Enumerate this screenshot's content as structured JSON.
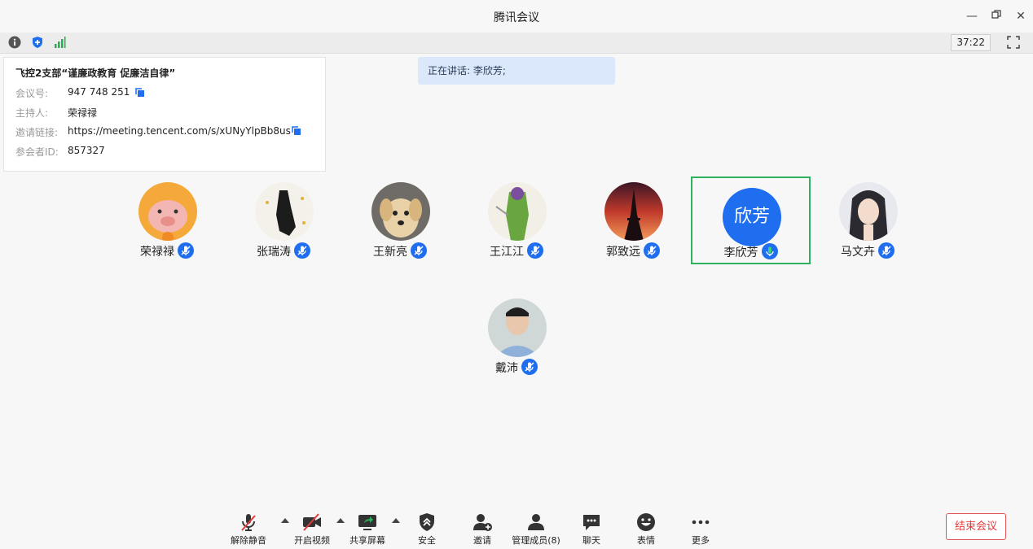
{
  "window": {
    "title": "腾讯会议"
  },
  "topbar": {
    "timer": "37:22"
  },
  "meeting": {
    "title": "飞控2支部“谨廉政教育 促廉洁自律”",
    "id_label": "会议号:",
    "id": "947 748 251",
    "host_label": "主持人:",
    "host": "荣禄禄",
    "link_label": "邀请链接:",
    "link": "https://meeting.tencent.com/s/xUNyYlpBb8us",
    "pid_label": "参会者ID:",
    "pid": "857327"
  },
  "speaking": {
    "text": "正在讲话: 李欣芳;"
  },
  "participants": [
    {
      "name": "荣禄禄",
      "avatar": "pig-cartoon"
    },
    {
      "name": "张瑞涛",
      "avatar": "ink-silhouette"
    },
    {
      "name": "王新亮",
      "avatar": "puppy-photo"
    },
    {
      "name": "王江江",
      "avatar": "anime-character"
    },
    {
      "name": "郭致远",
      "avatar": "eiffel-sunset"
    },
    {
      "name": "李欣芳",
      "avatar_text": "欣芳",
      "speaking": true
    },
    {
      "name": "马文卉",
      "avatar": "girl-portrait"
    },
    {
      "name": "戴沛",
      "avatar": "man-portrait"
    }
  ],
  "toolbar": {
    "unmute": "解除静音",
    "video": "开启视频",
    "share": "共享屏幕",
    "security": "安全",
    "invite": "邀请",
    "members": "管理成员(8)",
    "chat": "聊天",
    "emoji": "表情",
    "more": "更多",
    "end": "结束会议"
  },
  "colors": {
    "accent": "#1f6ef0",
    "active_border": "#2db25f",
    "danger": "#e23b3b"
  }
}
